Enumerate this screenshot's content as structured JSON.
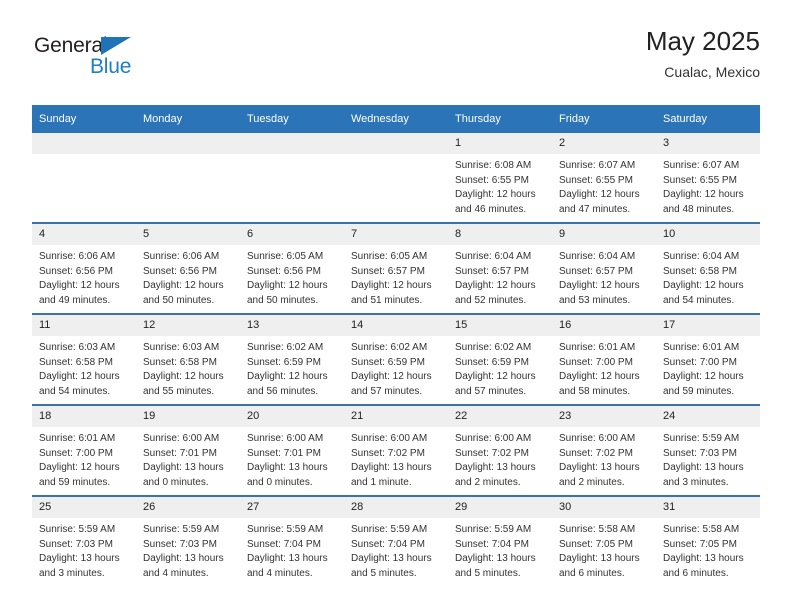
{
  "brand": {
    "name_dark": "General",
    "name_blue": "Blue",
    "accent_color": "#1f7ec4"
  },
  "header": {
    "title": "May 2025",
    "subtitle": "Cualac, Mexico",
    "header_bg": "#2b74b8"
  },
  "weekdays": [
    "Sunday",
    "Monday",
    "Tuesday",
    "Wednesday",
    "Thursday",
    "Friday",
    "Saturday"
  ],
  "weeks": [
    [
      {
        "day": "",
        "empty": true,
        "sunrise": "",
        "sunset": "",
        "daylight1": "",
        "daylight2": ""
      },
      {
        "day": "",
        "empty": true,
        "sunrise": "",
        "sunset": "",
        "daylight1": "",
        "daylight2": ""
      },
      {
        "day": "",
        "empty": true,
        "sunrise": "",
        "sunset": "",
        "daylight1": "",
        "daylight2": ""
      },
      {
        "day": "",
        "empty": true,
        "sunrise": "",
        "sunset": "",
        "daylight1": "",
        "daylight2": ""
      },
      {
        "day": "1",
        "sunrise": "Sunrise: 6:08 AM",
        "sunset": "Sunset: 6:55 PM",
        "daylight1": "Daylight: 12 hours",
        "daylight2": "and 46 minutes."
      },
      {
        "day": "2",
        "sunrise": "Sunrise: 6:07 AM",
        "sunset": "Sunset: 6:55 PM",
        "daylight1": "Daylight: 12 hours",
        "daylight2": "and 47 minutes."
      },
      {
        "day": "3",
        "sunrise": "Sunrise: 6:07 AM",
        "sunset": "Sunset: 6:55 PM",
        "daylight1": "Daylight: 12 hours",
        "daylight2": "and 48 minutes."
      }
    ],
    [
      {
        "day": "4",
        "sunrise": "Sunrise: 6:06 AM",
        "sunset": "Sunset: 6:56 PM",
        "daylight1": "Daylight: 12 hours",
        "daylight2": "and 49 minutes."
      },
      {
        "day": "5",
        "sunrise": "Sunrise: 6:06 AM",
        "sunset": "Sunset: 6:56 PM",
        "daylight1": "Daylight: 12 hours",
        "daylight2": "and 50 minutes."
      },
      {
        "day": "6",
        "sunrise": "Sunrise: 6:05 AM",
        "sunset": "Sunset: 6:56 PM",
        "daylight1": "Daylight: 12 hours",
        "daylight2": "and 50 minutes."
      },
      {
        "day": "7",
        "sunrise": "Sunrise: 6:05 AM",
        "sunset": "Sunset: 6:57 PM",
        "daylight1": "Daylight: 12 hours",
        "daylight2": "and 51 minutes."
      },
      {
        "day": "8",
        "sunrise": "Sunrise: 6:04 AM",
        "sunset": "Sunset: 6:57 PM",
        "daylight1": "Daylight: 12 hours",
        "daylight2": "and 52 minutes."
      },
      {
        "day": "9",
        "sunrise": "Sunrise: 6:04 AM",
        "sunset": "Sunset: 6:57 PM",
        "daylight1": "Daylight: 12 hours",
        "daylight2": "and 53 minutes."
      },
      {
        "day": "10",
        "sunrise": "Sunrise: 6:04 AM",
        "sunset": "Sunset: 6:58 PM",
        "daylight1": "Daylight: 12 hours",
        "daylight2": "and 54 minutes."
      }
    ],
    [
      {
        "day": "11",
        "sunrise": "Sunrise: 6:03 AM",
        "sunset": "Sunset: 6:58 PM",
        "daylight1": "Daylight: 12 hours",
        "daylight2": "and 54 minutes."
      },
      {
        "day": "12",
        "sunrise": "Sunrise: 6:03 AM",
        "sunset": "Sunset: 6:58 PM",
        "daylight1": "Daylight: 12 hours",
        "daylight2": "and 55 minutes."
      },
      {
        "day": "13",
        "sunrise": "Sunrise: 6:02 AM",
        "sunset": "Sunset: 6:59 PM",
        "daylight1": "Daylight: 12 hours",
        "daylight2": "and 56 minutes."
      },
      {
        "day": "14",
        "sunrise": "Sunrise: 6:02 AM",
        "sunset": "Sunset: 6:59 PM",
        "daylight1": "Daylight: 12 hours",
        "daylight2": "and 57 minutes."
      },
      {
        "day": "15",
        "sunrise": "Sunrise: 6:02 AM",
        "sunset": "Sunset: 6:59 PM",
        "daylight1": "Daylight: 12 hours",
        "daylight2": "and 57 minutes."
      },
      {
        "day": "16",
        "sunrise": "Sunrise: 6:01 AM",
        "sunset": "Sunset: 7:00 PM",
        "daylight1": "Daylight: 12 hours",
        "daylight2": "and 58 minutes."
      },
      {
        "day": "17",
        "sunrise": "Sunrise: 6:01 AM",
        "sunset": "Sunset: 7:00 PM",
        "daylight1": "Daylight: 12 hours",
        "daylight2": "and 59 minutes."
      }
    ],
    [
      {
        "day": "18",
        "sunrise": "Sunrise: 6:01 AM",
        "sunset": "Sunset: 7:00 PM",
        "daylight1": "Daylight: 12 hours",
        "daylight2": "and 59 minutes."
      },
      {
        "day": "19",
        "sunrise": "Sunrise: 6:00 AM",
        "sunset": "Sunset: 7:01 PM",
        "daylight1": "Daylight: 13 hours",
        "daylight2": "and 0 minutes."
      },
      {
        "day": "20",
        "sunrise": "Sunrise: 6:00 AM",
        "sunset": "Sunset: 7:01 PM",
        "daylight1": "Daylight: 13 hours",
        "daylight2": "and 0 minutes."
      },
      {
        "day": "21",
        "sunrise": "Sunrise: 6:00 AM",
        "sunset": "Sunset: 7:02 PM",
        "daylight1": "Daylight: 13 hours",
        "daylight2": "and 1 minute."
      },
      {
        "day": "22",
        "sunrise": "Sunrise: 6:00 AM",
        "sunset": "Sunset: 7:02 PM",
        "daylight1": "Daylight: 13 hours",
        "daylight2": "and 2 minutes."
      },
      {
        "day": "23",
        "sunrise": "Sunrise: 6:00 AM",
        "sunset": "Sunset: 7:02 PM",
        "daylight1": "Daylight: 13 hours",
        "daylight2": "and 2 minutes."
      },
      {
        "day": "24",
        "sunrise": "Sunrise: 5:59 AM",
        "sunset": "Sunset: 7:03 PM",
        "daylight1": "Daylight: 13 hours",
        "daylight2": "and 3 minutes."
      }
    ],
    [
      {
        "day": "25",
        "sunrise": "Sunrise: 5:59 AM",
        "sunset": "Sunset: 7:03 PM",
        "daylight1": "Daylight: 13 hours",
        "daylight2": "and 3 minutes."
      },
      {
        "day": "26",
        "sunrise": "Sunrise: 5:59 AM",
        "sunset": "Sunset: 7:03 PM",
        "daylight1": "Daylight: 13 hours",
        "daylight2": "and 4 minutes."
      },
      {
        "day": "27",
        "sunrise": "Sunrise: 5:59 AM",
        "sunset": "Sunset: 7:04 PM",
        "daylight1": "Daylight: 13 hours",
        "daylight2": "and 4 minutes."
      },
      {
        "day": "28",
        "sunrise": "Sunrise: 5:59 AM",
        "sunset": "Sunset: 7:04 PM",
        "daylight1": "Daylight: 13 hours",
        "daylight2": "and 5 minutes."
      },
      {
        "day": "29",
        "sunrise": "Sunrise: 5:59 AM",
        "sunset": "Sunset: 7:04 PM",
        "daylight1": "Daylight: 13 hours",
        "daylight2": "and 5 minutes."
      },
      {
        "day": "30",
        "sunrise": "Sunrise: 5:58 AM",
        "sunset": "Sunset: 7:05 PM",
        "daylight1": "Daylight: 13 hours",
        "daylight2": "and 6 minutes."
      },
      {
        "day": "31",
        "sunrise": "Sunrise: 5:58 AM",
        "sunset": "Sunset: 7:05 PM",
        "daylight1": "Daylight: 13 hours",
        "daylight2": "and 6 minutes."
      }
    ]
  ]
}
